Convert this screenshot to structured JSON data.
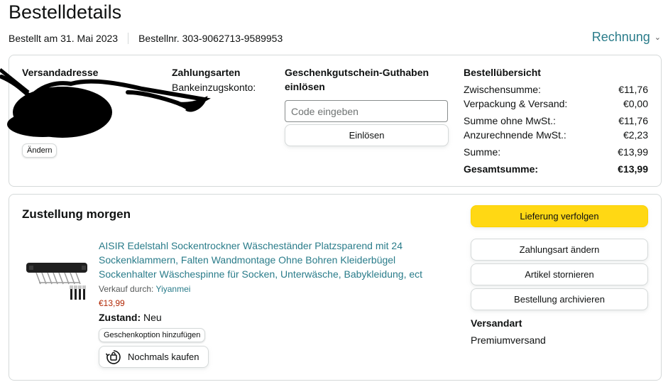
{
  "header": {
    "title": "Bestelldetails",
    "ordered_on": "Bestellt am 31. Mai 2023",
    "order_number": "Bestellnr. 303-9062713-9589953",
    "invoice_label": "Rechnung"
  },
  "shipping": {
    "heading": "Versandadresse",
    "change_label": "Ändern"
  },
  "payment": {
    "heading": "Zahlungsarten",
    "method": "Bankeinzugskonto:"
  },
  "giftcard": {
    "heading_line1": "Geschenkgutschein-Guthaben",
    "heading_line2": "einlösen",
    "placeholder": "Code eingeben",
    "redeem_label": "Einlösen"
  },
  "summary": {
    "heading": "Bestellübersicht",
    "rows": [
      {
        "label": "Zwischensumme:",
        "value": "€11,76"
      },
      {
        "label": "Verpackung & Versand:",
        "value": "€0,00"
      },
      {
        "label": "Summe ohne MwSt.:",
        "value": "€11,76"
      },
      {
        "label": "Anzurechnende MwSt.:",
        "value": "€2,23"
      },
      {
        "label": "Summe:",
        "value": "€13,99"
      },
      {
        "label": "Gesamtsumme:",
        "value": "€13,99"
      }
    ]
  },
  "delivery": {
    "title": "Zustellung morgen",
    "product_title": "AISIR Edelstahl Sockentrockner Wäscheständer Platzsparend mit 24 Sockenklammern, Falten Wandmontage Ohne Bohren Kleiderbügel Sockenhalter Wäschespinne für Socken, Unterwäsche, Babykleidung, ect",
    "seller_prefix": "Verkauf durch:",
    "seller_name": "Yiyanmei",
    "price": "€13,99",
    "condition_label": "Zustand:",
    "condition_value": "Neu",
    "gift_option_label": "Geschenkoption hinzufügen",
    "buy_again_label": "Nochmals kaufen"
  },
  "actions": {
    "track": "Lieferung verfolgen",
    "change_payment": "Zahlungsart ändern",
    "cancel": "Artikel stornieren",
    "archive": "Bestellung archivieren"
  },
  "shipping_type": {
    "heading": "Versandart",
    "value": "Premiumversand"
  },
  "colors": {
    "link": "#2a7c8a",
    "primary_button": "#ffd814",
    "price": "#b12704",
    "border": "#d5d9d9"
  }
}
